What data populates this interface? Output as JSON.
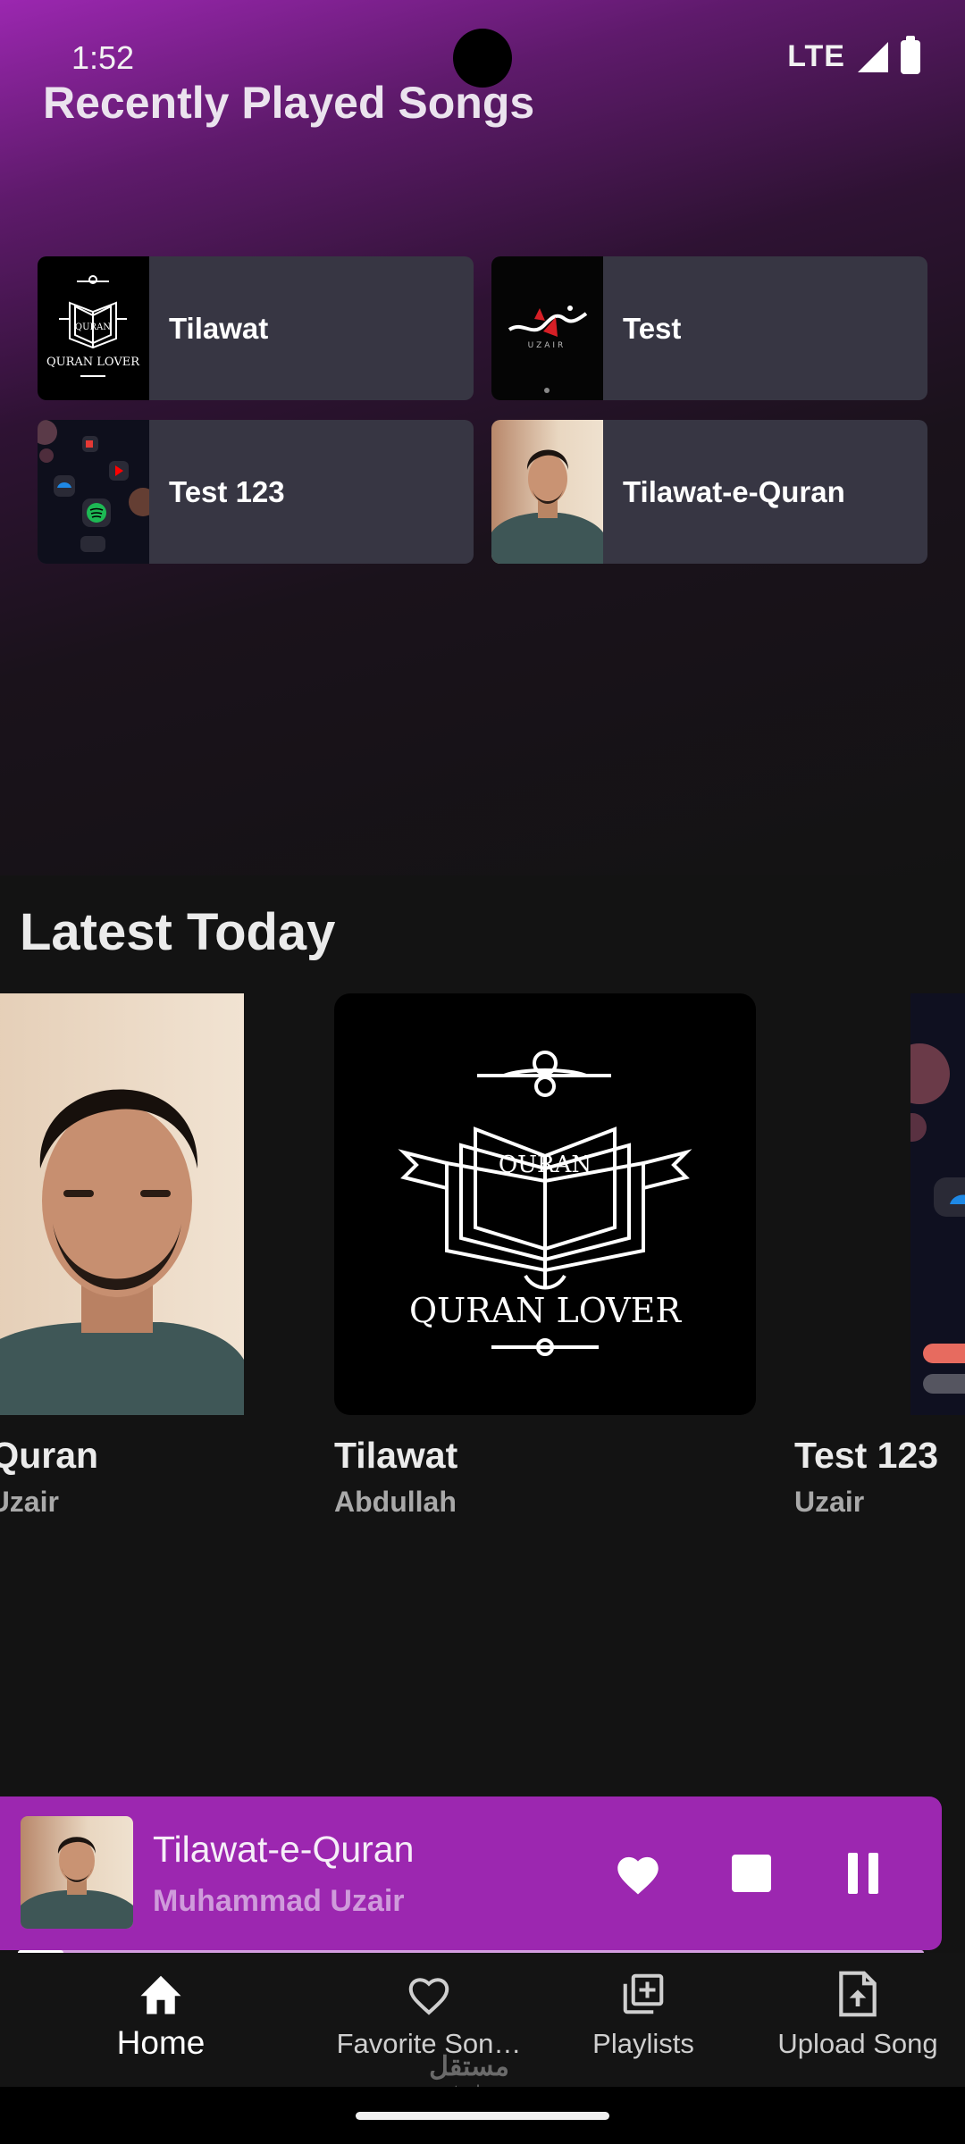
{
  "status_bar": {
    "time": "1:52",
    "network": "LTE"
  },
  "recently_played": {
    "title": "Recently Played Songs",
    "items": [
      {
        "title": "Tilawat",
        "art": "quran-lover-art"
      },
      {
        "title": "Test",
        "art": "calligraphy-art"
      },
      {
        "title": "Test 123",
        "art": "app-icons-art"
      },
      {
        "title": "Tilawat-e-Quran",
        "art": "portrait-photo"
      }
    ]
  },
  "latest_today": {
    "title": "Latest Today",
    "items": [
      {
        "title": "Tilawat-e-Quran",
        "artist": "Muhammad Uzair",
        "art": "portrait-photo"
      },
      {
        "title": "Tilawat",
        "artist": "Abdullah",
        "art": "quran-lover-art"
      },
      {
        "title": "Test 123",
        "artist": "Uzair",
        "art": "app-screenshot-art"
      }
    ]
  },
  "art_text": {
    "quran": "QURAN",
    "quran_lover": "QURAN LOVER",
    "uzair": "UZAIR"
  },
  "now_playing": {
    "title": "Tilawat-e-Quran",
    "artist": "Muhammad Uzair",
    "progress": 0.05,
    "favorited": true
  },
  "bottom_nav": {
    "items": [
      {
        "label": "Home",
        "icon": "home-icon",
        "active": true
      },
      {
        "label": "Favorite Son…",
        "icon": "heart-outline-icon",
        "active": false
      },
      {
        "label": "Playlists",
        "icon": "playlist-add-icon",
        "active": false
      },
      {
        "label": "Upload Song",
        "icon": "upload-file-icon",
        "active": false
      }
    ]
  },
  "watermark": {
    "line1": "مستقل",
    "line2": "mostaql.com"
  },
  "colors": {
    "accent": "#9c27b0",
    "card": "#373643",
    "background": "#131313"
  }
}
